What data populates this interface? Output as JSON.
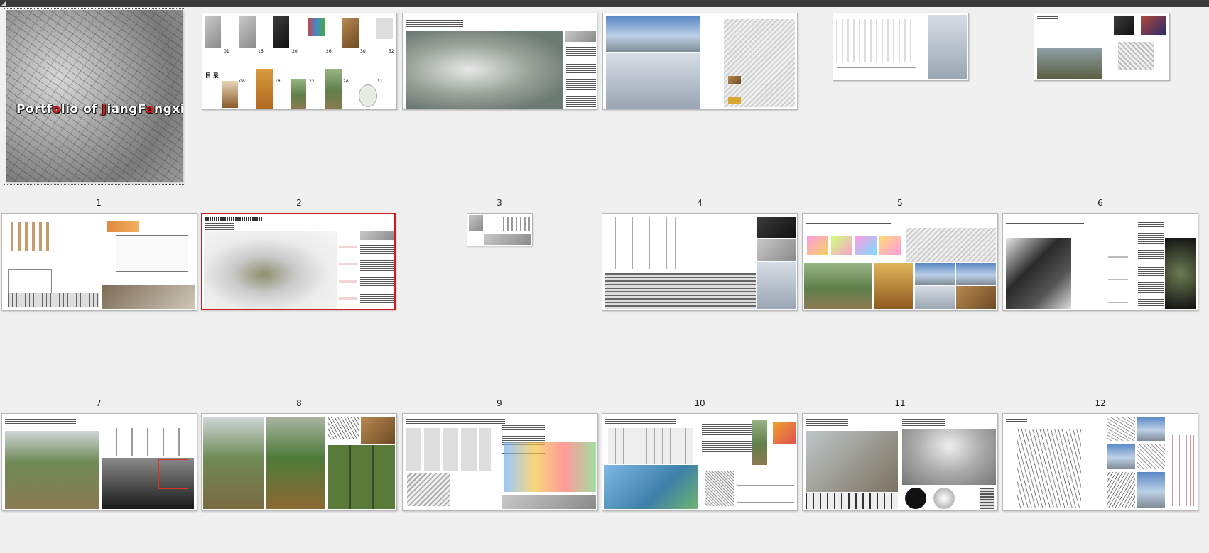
{
  "cover": {
    "title_parts": [
      {
        "text": "P",
        "red": false
      },
      {
        "text": "ortf",
        "red": false
      },
      {
        "text": "o",
        "red": true
      },
      {
        "text": "lio of ",
        "red": false
      },
      {
        "text": "J",
        "red": true
      },
      {
        "text": "iangF",
        "red": false
      },
      {
        "text": "a",
        "red": true
      },
      {
        "text": "ngxin",
        "red": false
      }
    ]
  },
  "pages": [
    {
      "label": "1"
    },
    {
      "label": "2"
    },
    {
      "label": "3"
    },
    {
      "label": "4"
    },
    {
      "label": "5"
    },
    {
      "label": "6"
    },
    {
      "label": "7"
    },
    {
      "label": "8"
    },
    {
      "label": "9"
    },
    {
      "label": "10"
    },
    {
      "label": "11"
    },
    {
      "label": "12"
    }
  ],
  "contents_heading": "目 录",
  "contents_numbers": [
    "01",
    "16",
    "20",
    "26",
    "30",
    "32",
    "08",
    "18",
    "22",
    "28",
    "31"
  ],
  "colors": {
    "selected_border": "#cc1f1f",
    "background": "#f0f0f0",
    "accent_red": "#d21f1f"
  }
}
